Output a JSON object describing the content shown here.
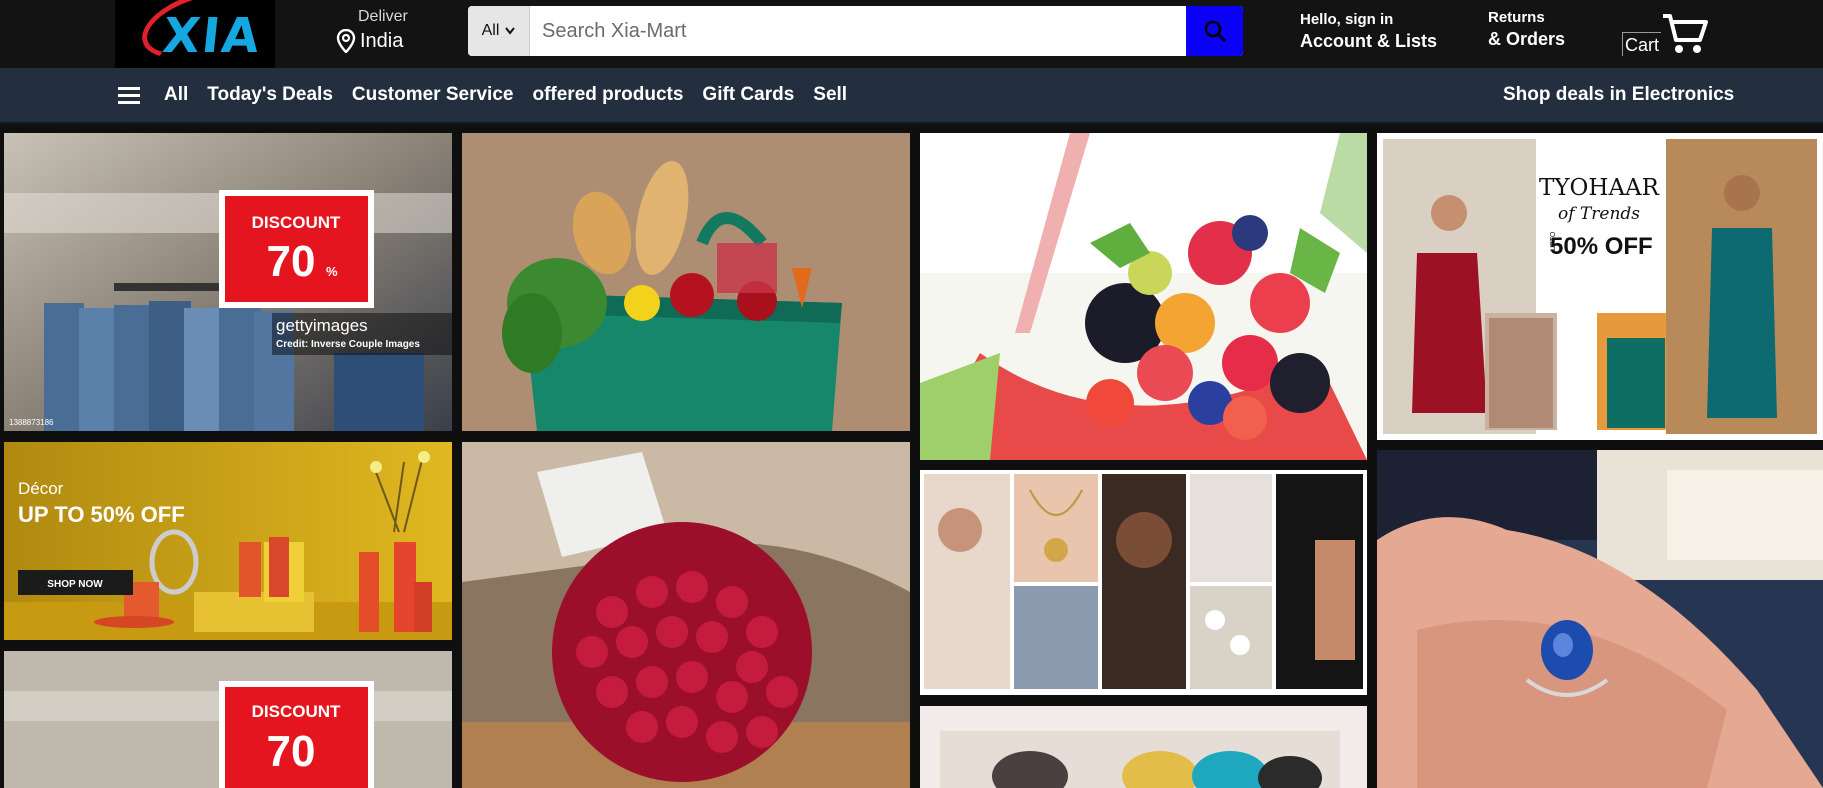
{
  "brand": {
    "logo_text": "XIA"
  },
  "header": {
    "deliver_label": "Deliver",
    "deliver_location": "India",
    "search": {
      "category": "All",
      "placeholder": "Search Xia-Mart"
    },
    "account": {
      "greeting": "Hello, sign in",
      "label": "Account & Lists"
    },
    "orders": {
      "line1": "Returns",
      "line2": "& Orders"
    },
    "cart_label": "Cart"
  },
  "nav": {
    "all_label": "All",
    "links": [
      "Today's Deals",
      "Customer Service",
      "offered products",
      "Gift Cards",
      "Sell"
    ],
    "promo": "Shop deals in Electronics"
  },
  "tiles": {
    "discount1": {
      "title": "DISCOUNT",
      "value": "70",
      "unit": "%",
      "watermark": "gettyimages",
      "credit": "Credit: Inverse Couple Images",
      "id": "1388873186"
    },
    "decor": {
      "kicker": "Décor",
      "headline": "UP TO 50% OFF",
      "cta": "SHOP NOW"
    },
    "discount2": {
      "title": "DISCOUNT",
      "value": "70"
    },
    "tyohaar": {
      "title": "TYOHAAR",
      "sub": "of Trends",
      "upto": "UPTO",
      "offer": "50% OFF"
    }
  },
  "colors": {
    "search_button": "#0a00f5",
    "navbar": "#232f3e",
    "topbar": "#131313",
    "discount_red": "#e4151f"
  }
}
